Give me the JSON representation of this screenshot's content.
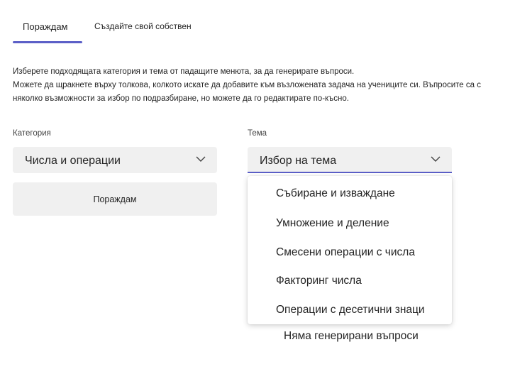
{
  "tabs": [
    {
      "label": "Пораждам",
      "active": true
    },
    {
      "label": "Създайте свой собствен",
      "active": false
    }
  ],
  "intro": {
    "line1": "Изберете подходящата категория и тема от падащите менюта, за да генерирате въпроси.",
    "line2": "Можете да щракнете върху толкова, колкото искате да добавите към възложената задача на учениците си. Въпросите са с",
    "line3": "няколко възможности за избор по подразбиране, но можете да го редактирате по-късно."
  },
  "category": {
    "label": "Категория",
    "value": "Числа и операции",
    "icon": "chevron-down-icon"
  },
  "topic": {
    "label": "Тема",
    "value": "Избор на тема",
    "icon": "chevron-down-icon",
    "options": [
      "Събиране и изваждане",
      "Умножение и деление",
      "Смесени операции с числа",
      "Факторинг числа",
      "Операции с десетични знаци"
    ]
  },
  "generate_button": {
    "label": "Пораждам"
  },
  "empty_state": {
    "message": "Няма генерирани въпроси"
  },
  "colors": {
    "accent": "#5b5fc7",
    "field_bg": "#f0f0f0",
    "text": "#242424"
  }
}
